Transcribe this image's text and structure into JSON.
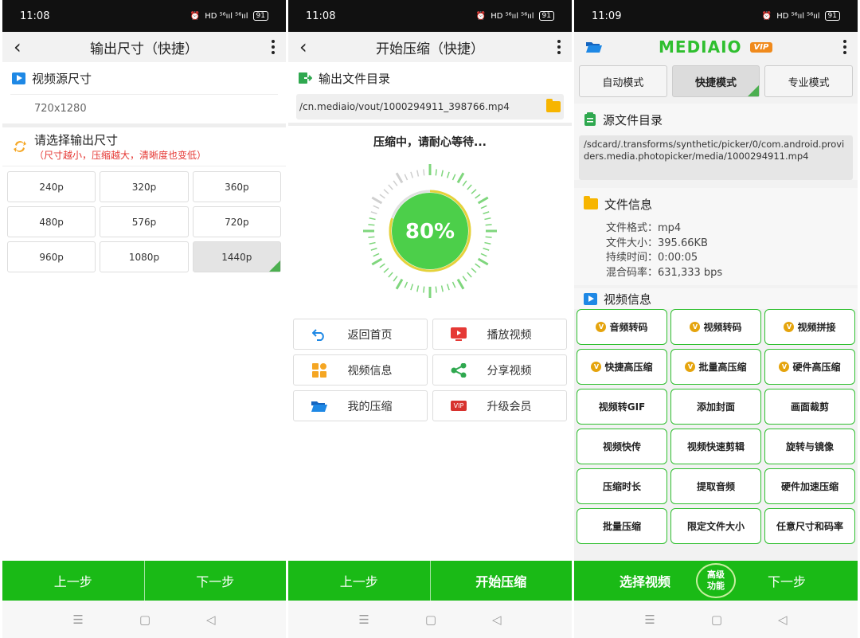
{
  "status": {
    "time1": "11:08",
    "time2": "11:08",
    "time3": "11:09",
    "signal": "HD ⁵⁶ııl ⁵⁶ııl",
    "battery": "91"
  },
  "screen1": {
    "title": "输出尺寸（快捷）",
    "source_label": "视频源尺寸",
    "source_value": "720x1280",
    "choose_label": "请选择输出尺寸",
    "choose_hint": "（尺寸越小，压缩越大，清晰度也变低）",
    "sizes": [
      "240p",
      "320p",
      "360p",
      "480p",
      "576p",
      "720p",
      "960p",
      "1080p",
      "1440p"
    ],
    "selected_size": "1440p",
    "prev": "上一步",
    "next": "下一步"
  },
  "screen2": {
    "title": "开始压缩（快捷）",
    "output_label": "输出文件目录",
    "output_path": "/cn.mediaio/vout/1000294911_398766.mp4",
    "wait_text": "压缩中，请耐心等待...",
    "progress_text": "80%",
    "progress": 0.8,
    "actions": [
      {
        "label": "返回首页",
        "icon": "return-icon"
      },
      {
        "label": "播放视频",
        "icon": "play-video-icon"
      },
      {
        "label": "视频信息",
        "icon": "grid-icon"
      },
      {
        "label": "分享视频",
        "icon": "share-icon"
      },
      {
        "label": "我的压缩",
        "icon": "folder-open-icon"
      },
      {
        "label": "升级会员",
        "icon": "vip-icon"
      }
    ],
    "vip_text": "VIP",
    "prev": "上一步",
    "start": "开始压缩"
  },
  "screen3": {
    "brand": "MEDIAIO",
    "vip": "VIP",
    "modes": [
      "自动模式",
      "快捷模式",
      "专业模式"
    ],
    "active_mode": "快捷模式",
    "source_dir_label": "源文件目录",
    "source_path": "/sdcard/.transforms/synthetic/picker/0/com.android.providers.media.photopicker/media/1000294911.mp4",
    "file_info_label": "文件信息",
    "file_info": [
      "文件格式：mp4",
      "文件大小：395.66KB",
      "持续时间：0:00:05",
      "混合码率：631,333 bps"
    ],
    "video_info_label": "视频信息",
    "features": [
      {
        "label": "音频转码",
        "vip": true
      },
      {
        "label": "视频转码",
        "vip": true
      },
      {
        "label": "视频拼接",
        "vip": true
      },
      {
        "label": "快捷高压缩",
        "vip": true
      },
      {
        "label": "批量高压缩",
        "vip": true
      },
      {
        "label": "硬件高压缩",
        "vip": true
      },
      {
        "label": "视频转GIF",
        "vip": false
      },
      {
        "label": "添加封面",
        "vip": false
      },
      {
        "label": "画面裁剪",
        "vip": false
      },
      {
        "label": "视频快传",
        "vip": false
      },
      {
        "label": "视频快速剪辑",
        "vip": false
      },
      {
        "label": "旋转与镜像",
        "vip": false
      },
      {
        "label": "压缩时长",
        "vip": false
      },
      {
        "label": "提取音频",
        "vip": false
      },
      {
        "label": "硬件加速压缩",
        "vip": false
      },
      {
        "label": "批量压缩",
        "vip": false
      },
      {
        "label": "限定文件大小",
        "vip": false
      },
      {
        "label": "任意尺寸和码率",
        "vip": false
      }
    ],
    "vip_badge": "V",
    "select_video": "选择视频",
    "advanced": "高级\n功能",
    "next": "下一步"
  },
  "nav": {
    "menu": "☰",
    "home": "▢",
    "back": "◁"
  },
  "colors": {
    "green": "#1aba16",
    "blue": "#1e88e5",
    "yellow": "#f7b500",
    "orange": "#e5a40d",
    "red": "#e53935"
  }
}
